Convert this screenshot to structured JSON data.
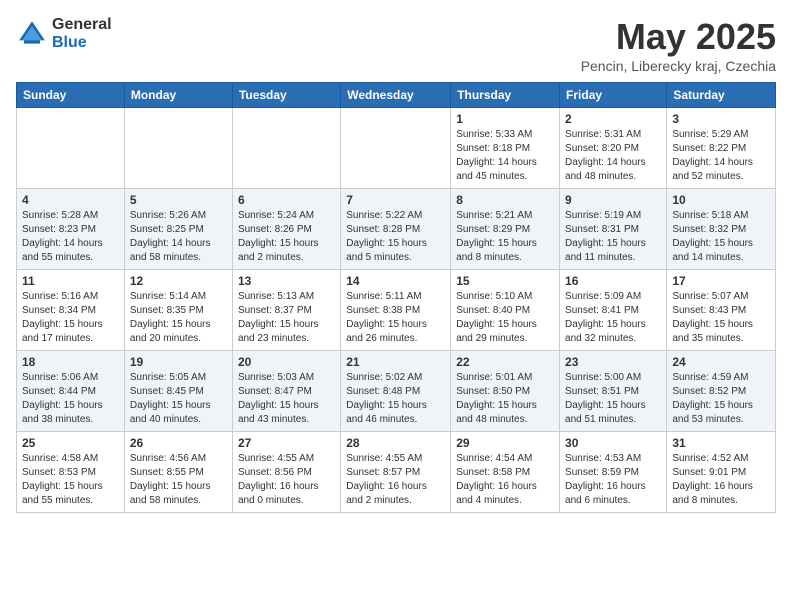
{
  "header": {
    "logo_general": "General",
    "logo_blue": "Blue",
    "month_year": "May 2025",
    "location": "Pencin, Liberecky kraj, Czechia"
  },
  "days_of_week": [
    "Sunday",
    "Monday",
    "Tuesday",
    "Wednesday",
    "Thursday",
    "Friday",
    "Saturday"
  ],
  "weeks": [
    [
      {
        "day": "",
        "info": ""
      },
      {
        "day": "",
        "info": ""
      },
      {
        "day": "",
        "info": ""
      },
      {
        "day": "",
        "info": ""
      },
      {
        "day": "1",
        "info": "Sunrise: 5:33 AM\nSunset: 8:18 PM\nDaylight: 14 hours\nand 45 minutes."
      },
      {
        "day": "2",
        "info": "Sunrise: 5:31 AM\nSunset: 8:20 PM\nDaylight: 14 hours\nand 48 minutes."
      },
      {
        "day": "3",
        "info": "Sunrise: 5:29 AM\nSunset: 8:22 PM\nDaylight: 14 hours\nand 52 minutes."
      }
    ],
    [
      {
        "day": "4",
        "info": "Sunrise: 5:28 AM\nSunset: 8:23 PM\nDaylight: 14 hours\nand 55 minutes."
      },
      {
        "day": "5",
        "info": "Sunrise: 5:26 AM\nSunset: 8:25 PM\nDaylight: 14 hours\nand 58 minutes."
      },
      {
        "day": "6",
        "info": "Sunrise: 5:24 AM\nSunset: 8:26 PM\nDaylight: 15 hours\nand 2 minutes."
      },
      {
        "day": "7",
        "info": "Sunrise: 5:22 AM\nSunset: 8:28 PM\nDaylight: 15 hours\nand 5 minutes."
      },
      {
        "day": "8",
        "info": "Sunrise: 5:21 AM\nSunset: 8:29 PM\nDaylight: 15 hours\nand 8 minutes."
      },
      {
        "day": "9",
        "info": "Sunrise: 5:19 AM\nSunset: 8:31 PM\nDaylight: 15 hours\nand 11 minutes."
      },
      {
        "day": "10",
        "info": "Sunrise: 5:18 AM\nSunset: 8:32 PM\nDaylight: 15 hours\nand 14 minutes."
      }
    ],
    [
      {
        "day": "11",
        "info": "Sunrise: 5:16 AM\nSunset: 8:34 PM\nDaylight: 15 hours\nand 17 minutes."
      },
      {
        "day": "12",
        "info": "Sunrise: 5:14 AM\nSunset: 8:35 PM\nDaylight: 15 hours\nand 20 minutes."
      },
      {
        "day": "13",
        "info": "Sunrise: 5:13 AM\nSunset: 8:37 PM\nDaylight: 15 hours\nand 23 minutes."
      },
      {
        "day": "14",
        "info": "Sunrise: 5:11 AM\nSunset: 8:38 PM\nDaylight: 15 hours\nand 26 minutes."
      },
      {
        "day": "15",
        "info": "Sunrise: 5:10 AM\nSunset: 8:40 PM\nDaylight: 15 hours\nand 29 minutes."
      },
      {
        "day": "16",
        "info": "Sunrise: 5:09 AM\nSunset: 8:41 PM\nDaylight: 15 hours\nand 32 minutes."
      },
      {
        "day": "17",
        "info": "Sunrise: 5:07 AM\nSunset: 8:43 PM\nDaylight: 15 hours\nand 35 minutes."
      }
    ],
    [
      {
        "day": "18",
        "info": "Sunrise: 5:06 AM\nSunset: 8:44 PM\nDaylight: 15 hours\nand 38 minutes."
      },
      {
        "day": "19",
        "info": "Sunrise: 5:05 AM\nSunset: 8:45 PM\nDaylight: 15 hours\nand 40 minutes."
      },
      {
        "day": "20",
        "info": "Sunrise: 5:03 AM\nSunset: 8:47 PM\nDaylight: 15 hours\nand 43 minutes."
      },
      {
        "day": "21",
        "info": "Sunrise: 5:02 AM\nSunset: 8:48 PM\nDaylight: 15 hours\nand 46 minutes."
      },
      {
        "day": "22",
        "info": "Sunrise: 5:01 AM\nSunset: 8:50 PM\nDaylight: 15 hours\nand 48 minutes."
      },
      {
        "day": "23",
        "info": "Sunrise: 5:00 AM\nSunset: 8:51 PM\nDaylight: 15 hours\nand 51 minutes."
      },
      {
        "day": "24",
        "info": "Sunrise: 4:59 AM\nSunset: 8:52 PM\nDaylight: 15 hours\nand 53 minutes."
      }
    ],
    [
      {
        "day": "25",
        "info": "Sunrise: 4:58 AM\nSunset: 8:53 PM\nDaylight: 15 hours\nand 55 minutes."
      },
      {
        "day": "26",
        "info": "Sunrise: 4:56 AM\nSunset: 8:55 PM\nDaylight: 15 hours\nand 58 minutes."
      },
      {
        "day": "27",
        "info": "Sunrise: 4:55 AM\nSunset: 8:56 PM\nDaylight: 16 hours\nand 0 minutes."
      },
      {
        "day": "28",
        "info": "Sunrise: 4:55 AM\nSunset: 8:57 PM\nDaylight: 16 hours\nand 2 minutes."
      },
      {
        "day": "29",
        "info": "Sunrise: 4:54 AM\nSunset: 8:58 PM\nDaylight: 16 hours\nand 4 minutes."
      },
      {
        "day": "30",
        "info": "Sunrise: 4:53 AM\nSunset: 8:59 PM\nDaylight: 16 hours\nand 6 minutes."
      },
      {
        "day": "31",
        "info": "Sunrise: 4:52 AM\nSunset: 9:01 PM\nDaylight: 16 hours\nand 8 minutes."
      }
    ]
  ]
}
